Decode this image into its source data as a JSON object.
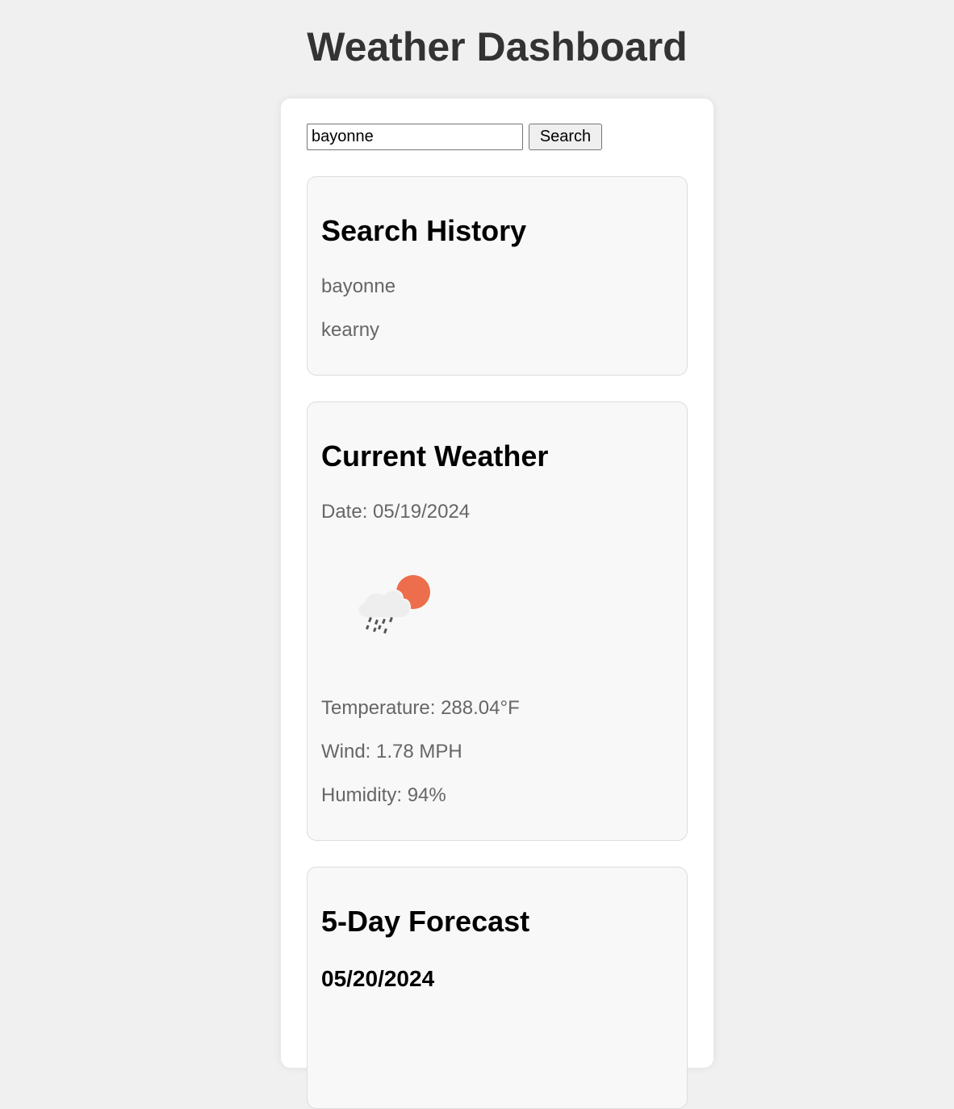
{
  "header": {
    "title": "Weather Dashboard"
  },
  "search": {
    "value": "bayonne",
    "button_label": "Search"
  },
  "history": {
    "title": "Search History",
    "items": [
      "bayonne",
      "kearny"
    ]
  },
  "current": {
    "title": "Current Weather",
    "date": "Date: 05/19/2024",
    "icon": "partly-cloudy-rain-icon",
    "temperature": "Temperature: 288.04°F",
    "wind": "Wind: 1.78 MPH",
    "humidity": "Humidity: 94%"
  },
  "forecast": {
    "title": "5-Day Forecast",
    "days": [
      {
        "date": "05/20/2024"
      }
    ]
  },
  "colors": {
    "background": "#f0f0f0",
    "title": "#333333",
    "muted_text": "#666666",
    "card_bg": "#f8f8f8",
    "sun": "#ec6e4c"
  }
}
